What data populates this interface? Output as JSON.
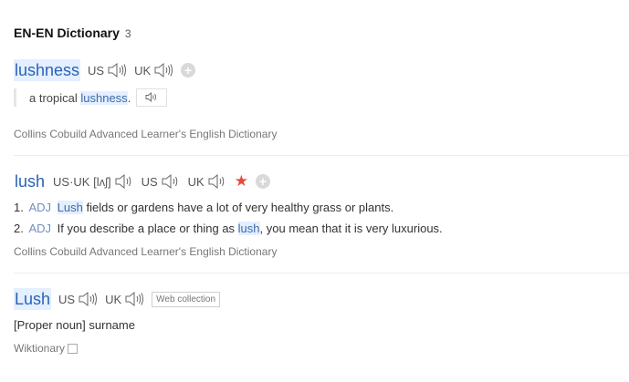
{
  "title": {
    "label": "EN-EN Dictionary",
    "count": "3"
  },
  "entry1": {
    "word": "lushness",
    "us": "US",
    "uk": "UK",
    "example": {
      "before": "a tropical ",
      "highlight": "lushness",
      "after": "."
    },
    "source": "Collins Cobuild Advanced Learner's English Dictionary"
  },
  "entry2": {
    "word": "lush",
    "usuk": "US·UK",
    "ipa": "[lʌʃ]",
    "us": "US",
    "uk": "UK",
    "definitions": [
      {
        "num": "1.",
        "pos": "ADJ",
        "highlight": "Lush",
        "text": " fields or gardens have a lot of very healthy grass or plants."
      },
      {
        "num": "2.",
        "pos": "ADJ",
        "before": "If you describe a place or thing as ",
        "highlight": "lush",
        "after": ", you mean that it is very luxurious."
      }
    ],
    "source": "Collins Cobuild Advanced Learner's English Dictionary"
  },
  "entry3": {
    "word": "Lush",
    "us": "US",
    "uk": "UK",
    "tag": "Web collection",
    "definition": "[Proper noun] surname",
    "source": "Wiktionary"
  },
  "colors": {
    "link": "#2b63b5",
    "highlight_bg": "#e4efff",
    "star": "#e54b3c",
    "pos": "#6f8fc0"
  },
  "icons": {
    "audio": "speaker-icon",
    "add": "plus-circle-icon",
    "favorite": "star-icon",
    "copy": "copy-icon"
  }
}
